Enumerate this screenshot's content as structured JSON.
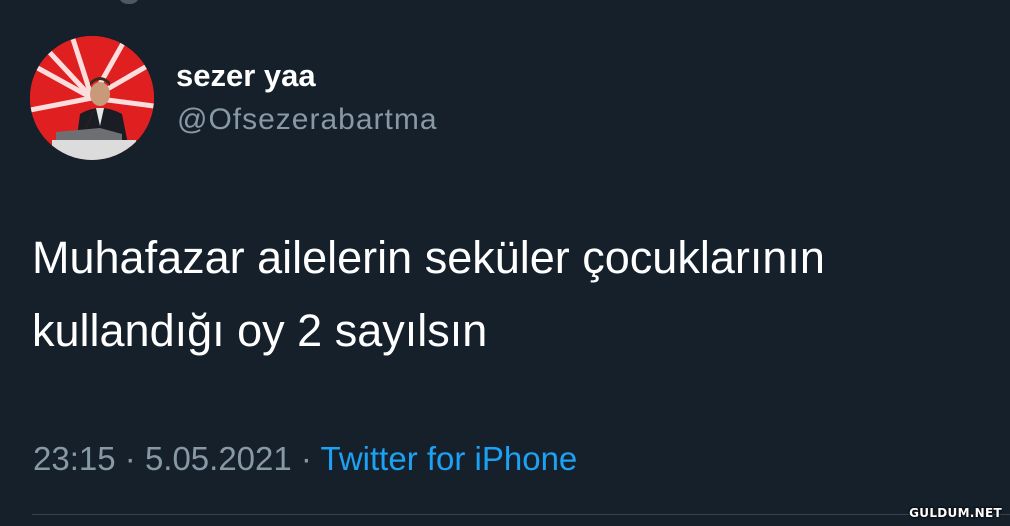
{
  "tweet": {
    "display_name": "sezer yaa",
    "username": "@Ofsezerabartma",
    "text_lines": [
      "Muhafazar ailelerin seküler çocuklarının",
      "kullandığı oy 2 sayılsın"
    ],
    "time": "23:15",
    "separator": "·",
    "date": "5.05.2021",
    "source": "Twitter for iPhone"
  },
  "watermark": "GULDUM.NET",
  "colors": {
    "background": "#15202b",
    "primary_text": "#ffffff",
    "secondary_text": "#8899a6",
    "link": "#1da1f2",
    "avatar_red": "#e02020"
  },
  "icons": {
    "avatar": "profile-photo-speaker-at-podium"
  }
}
